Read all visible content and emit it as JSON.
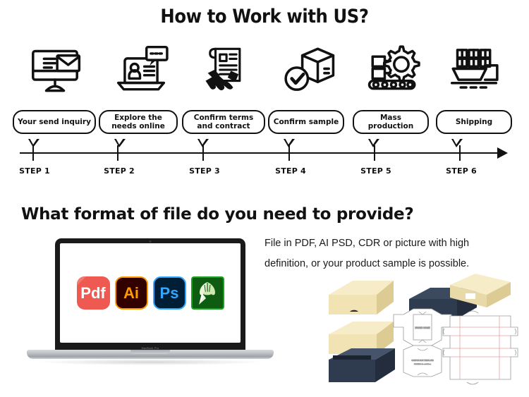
{
  "headings": {
    "main": "How to Work with US?",
    "secondary": "What format of file do you need to provide?"
  },
  "process": {
    "steps": [
      {
        "id": 1,
        "icon": "monitor-email-icon",
        "bubble": "Your send inquiry",
        "tick_label": "STEP 1"
      },
      {
        "id": 2,
        "icon": "laptop-chat-icon",
        "bubble": "Explore the needs online",
        "tick_label": "STEP 2"
      },
      {
        "id": 3,
        "icon": "handshake-contract-icon",
        "bubble": "Confirm terms and contract",
        "tick_label": "STEP 3"
      },
      {
        "id": 4,
        "icon": "box-check-icon",
        "bubble": "Confirm sample",
        "tick_label": "STEP 4"
      },
      {
        "id": 5,
        "icon": "gear-conveyor-icon",
        "bubble": "Mass production",
        "tick_label": "STEP 5"
      },
      {
        "id": 6,
        "icon": "cargo-ship-icon",
        "bubble": "Shipping",
        "tick_label": "STEP 6"
      }
    ],
    "axis": {
      "style": "arrow-right",
      "color": "#111111"
    }
  },
  "file_formats": {
    "description": "File in PDF, AI PSD, CDR or picture with high definition, or your product sample is possible.",
    "laptop_brand": "MacBook Pro",
    "apps": [
      {
        "name": "pdf-icon",
        "label": "Pdf",
        "bg": "#ee5a52",
        "fg": "#ffffff"
      },
      {
        "name": "illustrator-icon",
        "label": "Ai",
        "bg": "#330000",
        "fg": "#ff9a00"
      },
      {
        "name": "photoshop-icon",
        "label": "Ps",
        "bg": "#001e36",
        "fg": "#31a8ff"
      },
      {
        "name": "coreldraw-icon",
        "label": "",
        "bg": "#0d5c12",
        "fg": "#c8e6a0"
      }
    ],
    "box_mockups": {
      "cream_color": "#f2e3b4",
      "navy_color": "#2f3b4e",
      "dieline_color": "#e8a0a0"
    }
  }
}
